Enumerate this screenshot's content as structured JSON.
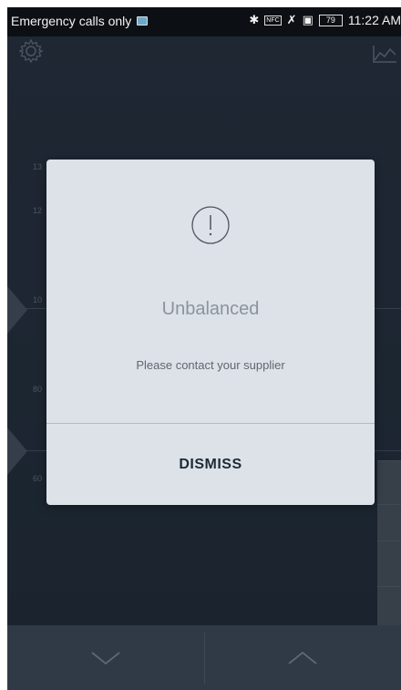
{
  "status_bar": {
    "carrier_text": "Emergency calls only",
    "bluetooth_icon": "bluetooth-icon",
    "nfc_label": "NFC",
    "battery_level": "79",
    "time": "11:22 AM"
  },
  "toolbar": {
    "settings_icon": "gear-icon",
    "stats_icon": "line-chart-icon"
  },
  "gauge": {
    "ticks": [
      "13",
      "12",
      "10",
      "80",
      "60"
    ]
  },
  "dialog": {
    "icon": "exclamation-circle-icon",
    "title": "Unbalanced",
    "message": "Please contact your supplier",
    "dismiss_label": "DISMISS"
  },
  "bottom_nav": {
    "down_icon": "chevron-down-icon",
    "up_icon": "chevron-up-icon"
  }
}
